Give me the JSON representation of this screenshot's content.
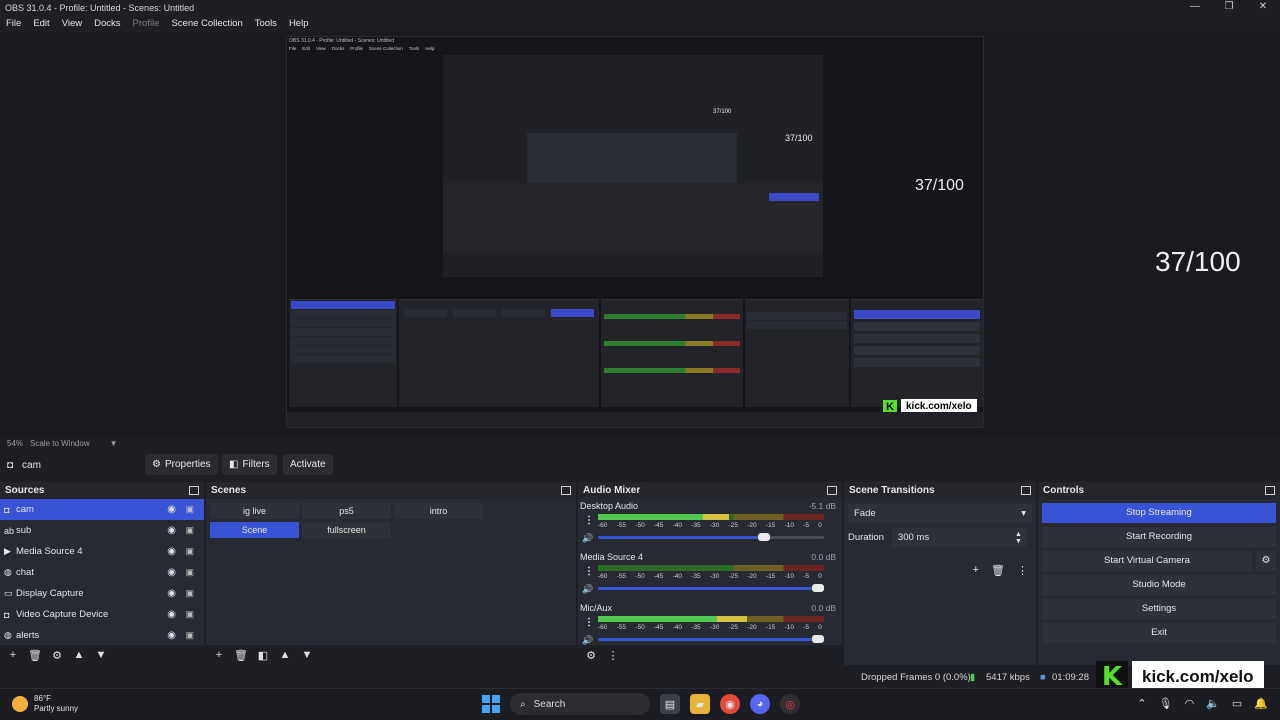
{
  "window": {
    "title": "OBS 31.0.4 - Profile: Untitled - Scenes: Untitled",
    "controls": [
      "—",
      "❐",
      "✕"
    ]
  },
  "menu": [
    "File",
    "Edit",
    "View",
    "Docks",
    "Profile",
    "Scene Collection",
    "Tools",
    "Help"
  ],
  "preview": {
    "counter": "37/100",
    "nested_counter_1": "37/100",
    "nested_counter_2": "37/100",
    "nested_counter_3": "37/100",
    "nested_kick": "kick.com/xelo",
    "nested_title": "OBS 31.0.4 - Profile: Untitled - Scenes: Untitled",
    "nested_menu": [
      "File",
      "Edit",
      "View",
      "Docks",
      "Profile",
      "Scene Collection",
      "Tools",
      "Help"
    ]
  },
  "status_line": {
    "zoom": "54%",
    "scale_mode": "Scale to Window"
  },
  "source_toolbar": {
    "selected": "cam",
    "properties": "Properties",
    "filters": "Filters",
    "activate": "Activate"
  },
  "sources": {
    "title": "Sources",
    "items": [
      {
        "icon": "camera-icon",
        "glyph": "◘",
        "label": "cam",
        "selected": true
      },
      {
        "icon": "text-icon",
        "glyph": "ab",
        "label": "sub",
        "selected": false
      },
      {
        "icon": "media-icon",
        "glyph": "▶",
        "label": "Media Source 4",
        "selected": false
      },
      {
        "icon": "browser-icon",
        "glyph": "◍",
        "label": "chat",
        "selected": false
      },
      {
        "icon": "display-icon",
        "glyph": "▭",
        "label": "Display Capture",
        "selected": false
      },
      {
        "icon": "camera-icon",
        "glyph": "◘",
        "label": "Video Capture Device",
        "selected": false
      },
      {
        "icon": "browser-icon",
        "glyph": "◍",
        "label": "alerts",
        "selected": false
      }
    ]
  },
  "scenes": {
    "title": "Scenes",
    "items": [
      {
        "label": "ig live",
        "selected": false
      },
      {
        "label": "ps5",
        "selected": false
      },
      {
        "label": "intro",
        "selected": false
      },
      {
        "label": "Scene",
        "selected": true
      },
      {
        "label": "fullscreen",
        "selected": false
      }
    ]
  },
  "mixer": {
    "title": "Audio Mixer",
    "scale": [
      "-60",
      "-55",
      "-50",
      "-45",
      "-40",
      "-35",
      "-30",
      "-25",
      "-20",
      "-15",
      "-10",
      "-5",
      "0"
    ],
    "channels": [
      {
        "name": "Desktop Audio",
        "db": "-5.1 dB",
        "level": 0.58,
        "volume": 0.76
      },
      {
        "name": "Media Source 4",
        "db": "0.0 dB",
        "level": 0,
        "volume": 1.0
      },
      {
        "name": "Mic/Aux",
        "db": "0.0 dB",
        "level": 0.66,
        "volume": 1.0
      }
    ]
  },
  "transitions": {
    "title": "Scene Transitions",
    "selected": "Fade",
    "duration_label": "Duration",
    "duration_value": "300 ms"
  },
  "controls": {
    "title": "Controls",
    "stop_streaming": "Stop Streaming",
    "start_recording": "Start Recording",
    "start_virtual_camera": "Start Virtual Camera",
    "studio_mode": "Studio Mode",
    "settings": "Settings",
    "exit": "Exit"
  },
  "obs_status": {
    "dropped_frames": "Dropped Frames 0 (0.0%)",
    "bitrate": "5417 kbps",
    "stream_time": "01:09:28"
  },
  "kick_overlay": {
    "text": "kick.com/xelo",
    "logo": "K"
  },
  "taskbar": {
    "weather_temp": "86°F",
    "weather_desc": "Partly sunny",
    "search": "Search"
  },
  "colors": {
    "accent": "#3953d6",
    "kick_green": "#54e02c",
    "dock_bg": "#272a33"
  }
}
